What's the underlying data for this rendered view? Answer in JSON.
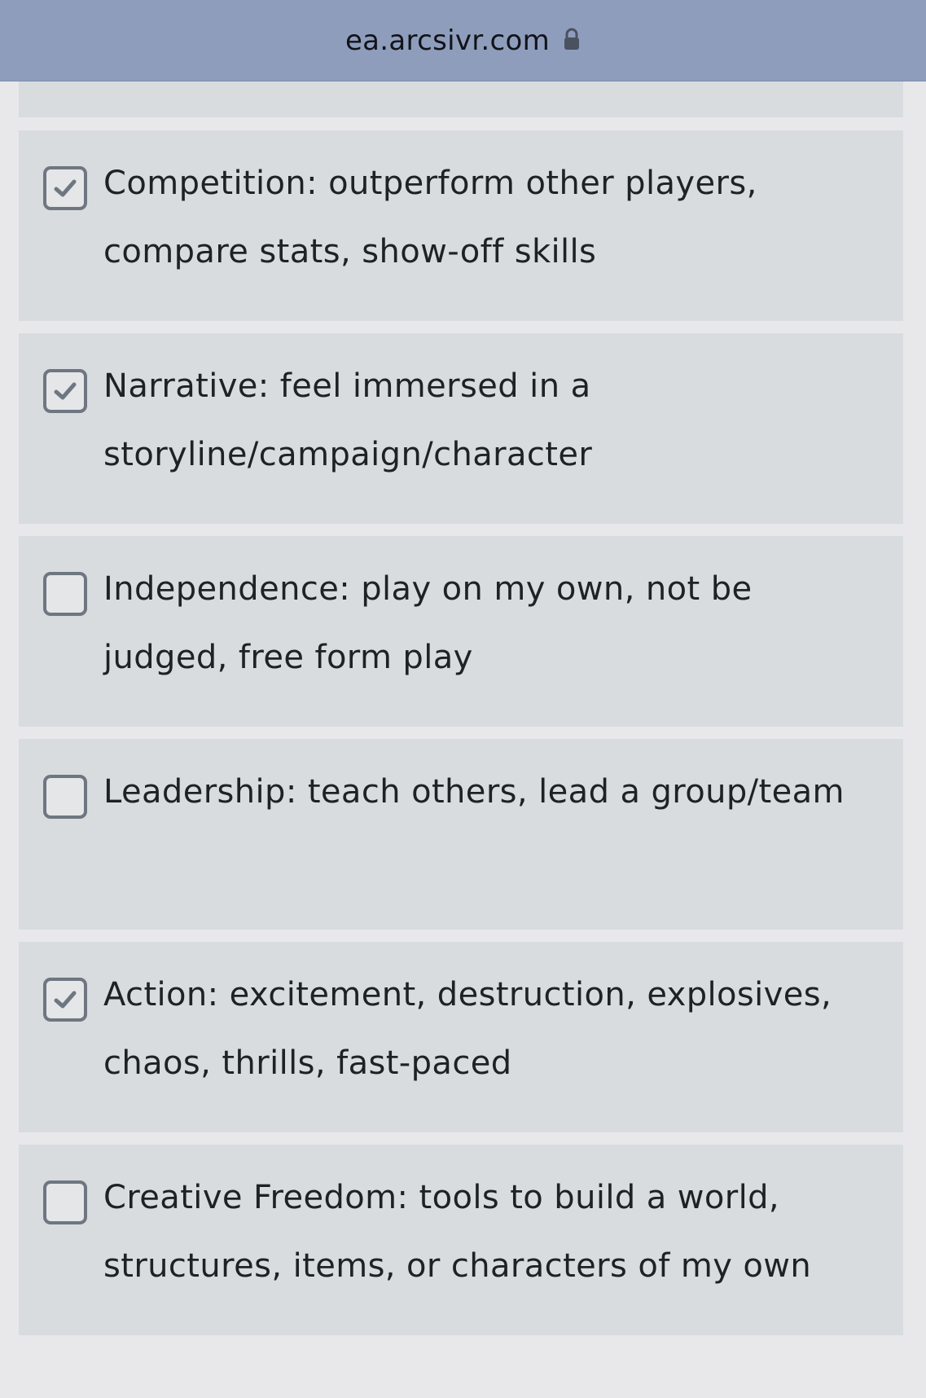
{
  "browser": {
    "url": "ea.arcsivr.com",
    "lock_icon": "lock-icon"
  },
  "options": [
    {
      "label": "Competition: outperform other players, compare stats, show-off skills",
      "checked": true
    },
    {
      "label": "Narrative: feel immersed in a storyline/campaign/character",
      "checked": true
    },
    {
      "label": "Independence: play on my own, not be judged, free form play",
      "checked": false
    },
    {
      "label": "Leadership: teach others, lead a group/team",
      "checked": false
    },
    {
      "label": "Action: excitement, destruction, explosives, chaos, thrills, fast-paced",
      "checked": true
    },
    {
      "label": "Creative Freedom: tools to build a world, structures, items, or characters of my own",
      "checked": false
    }
  ],
  "colors": {
    "header_bg": "#8f9dbd",
    "page_bg": "#e8e8ea",
    "card_bg": "#d9dcde",
    "checkbox_border": "#6e7781",
    "text": "#1e2226"
  }
}
